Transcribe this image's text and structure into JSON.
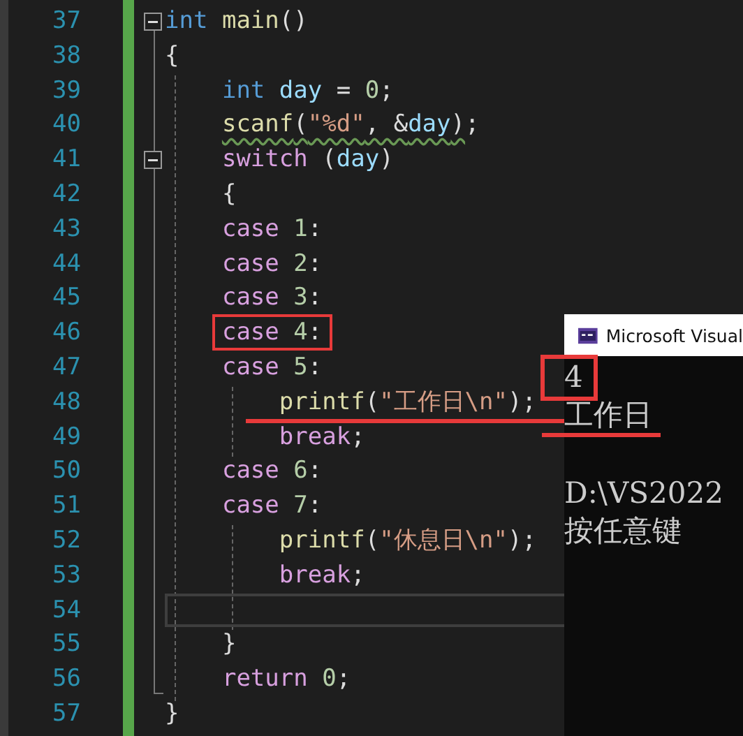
{
  "editor": {
    "lines": [
      {
        "number": "37",
        "fold": true,
        "current": false,
        "boxed": false,
        "underlined": false,
        "tokens": [
          {
            "t": "int",
            "kind": "kw"
          },
          {
            "t": " main",
            "kind": "fn"
          },
          {
            "t": "()",
            "kind": "op"
          }
        ]
      },
      {
        "number": "38",
        "fold": false,
        "current": false,
        "boxed": false,
        "underlined": false,
        "tokens": [
          {
            "t": "{",
            "kind": "op"
          }
        ]
      },
      {
        "number": "39",
        "fold": false,
        "current": false,
        "boxed": false,
        "underlined": false,
        "tokens": [
          {
            "t": "    int",
            "kind": "kw"
          },
          {
            "t": " day",
            "kind": "var"
          },
          {
            "t": " = ",
            "kind": "op"
          },
          {
            "t": "0",
            "kind": "num"
          },
          {
            "t": ";",
            "kind": "op"
          }
        ]
      },
      {
        "number": "40",
        "fold": false,
        "current": false,
        "boxed": false,
        "underlined": false,
        "tokens": [
          {
            "t": "    scanf",
            "kind": "fn",
            "squiggle": true
          },
          {
            "t": "(",
            "kind": "op",
            "squiggle": true
          },
          {
            "t": "\"%d\"",
            "kind": "str",
            "squiggle": true
          },
          {
            "t": ", &",
            "kind": "op",
            "squiggle": true
          },
          {
            "t": "day",
            "kind": "var",
            "squiggle": true
          },
          {
            "t": ")",
            "kind": "op",
            "squiggle": true
          },
          {
            "t": ";",
            "kind": "op",
            "squiggle": false
          }
        ]
      },
      {
        "number": "41",
        "fold": true,
        "current": false,
        "boxed": false,
        "underlined": false,
        "tokens": [
          {
            "t": "    switch",
            "kind": "ctl"
          },
          {
            "t": " (",
            "kind": "op"
          },
          {
            "t": "day",
            "kind": "var"
          },
          {
            "t": ")",
            "kind": "op"
          }
        ]
      },
      {
        "number": "42",
        "fold": false,
        "current": false,
        "boxed": false,
        "underlined": false,
        "tokens": [
          {
            "t": "    {",
            "kind": "op"
          }
        ]
      },
      {
        "number": "43",
        "fold": false,
        "current": false,
        "boxed": false,
        "underlined": false,
        "tokens": [
          {
            "t": "    case",
            "kind": "ctl"
          },
          {
            "t": " 1",
            "kind": "num"
          },
          {
            "t": ":",
            "kind": "op"
          }
        ]
      },
      {
        "number": "44",
        "fold": false,
        "current": false,
        "boxed": false,
        "underlined": false,
        "tokens": [
          {
            "t": "    case",
            "kind": "ctl"
          },
          {
            "t": " 2",
            "kind": "num"
          },
          {
            "t": ":",
            "kind": "op"
          }
        ]
      },
      {
        "number": "45",
        "fold": false,
        "current": false,
        "boxed": false,
        "underlined": false,
        "tokens": [
          {
            "t": "    case",
            "kind": "ctl"
          },
          {
            "t": " 3",
            "kind": "num"
          },
          {
            "t": ":",
            "kind": "op"
          }
        ]
      },
      {
        "number": "46",
        "fold": false,
        "current": false,
        "boxed": true,
        "underlined": false,
        "tokens": [
          {
            "t": "    case",
            "kind": "ctl"
          },
          {
            "t": " 4",
            "kind": "num"
          },
          {
            "t": ":",
            "kind": "op"
          }
        ]
      },
      {
        "number": "47",
        "fold": false,
        "current": false,
        "boxed": false,
        "underlined": false,
        "tokens": [
          {
            "t": "    case",
            "kind": "ctl"
          },
          {
            "t": " 5",
            "kind": "num"
          },
          {
            "t": ":",
            "kind": "op"
          }
        ]
      },
      {
        "number": "48",
        "fold": false,
        "current": false,
        "boxed": false,
        "underlined": true,
        "tokens": [
          {
            "t": "        printf",
            "kind": "fn"
          },
          {
            "t": "(",
            "kind": "op"
          },
          {
            "t": "\"工作日\\n\"",
            "kind": "str"
          },
          {
            "t": ");",
            "kind": "op"
          }
        ]
      },
      {
        "number": "49",
        "fold": false,
        "current": false,
        "boxed": false,
        "underlined": false,
        "tokens": [
          {
            "t": "        break",
            "kind": "ctl"
          },
          {
            "t": ";",
            "kind": "op"
          }
        ]
      },
      {
        "number": "50",
        "fold": false,
        "current": false,
        "boxed": false,
        "underlined": false,
        "tokens": [
          {
            "t": "    case",
            "kind": "ctl"
          },
          {
            "t": " 6",
            "kind": "num"
          },
          {
            "t": ":",
            "kind": "op"
          }
        ]
      },
      {
        "number": "51",
        "fold": false,
        "current": false,
        "boxed": false,
        "underlined": false,
        "tokens": [
          {
            "t": "    case",
            "kind": "ctl"
          },
          {
            "t": " 7",
            "kind": "num"
          },
          {
            "t": ":",
            "kind": "op"
          }
        ]
      },
      {
        "number": "52",
        "fold": false,
        "current": false,
        "boxed": false,
        "underlined": false,
        "tokens": [
          {
            "t": "        printf",
            "kind": "fn"
          },
          {
            "t": "(",
            "kind": "op"
          },
          {
            "t": "\"休息日\\n\"",
            "kind": "str"
          },
          {
            "t": ");",
            "kind": "op"
          }
        ]
      },
      {
        "number": "53",
        "fold": false,
        "current": false,
        "boxed": false,
        "underlined": false,
        "tokens": [
          {
            "t": "        break",
            "kind": "ctl"
          },
          {
            "t": ";",
            "kind": "op"
          }
        ]
      },
      {
        "number": "54",
        "fold": false,
        "current": true,
        "boxed": false,
        "underlined": false
      },
      {
        "number": "55",
        "fold": false,
        "current": false,
        "boxed": false,
        "underlined": false,
        "tokens": [
          {
            "t": "    }",
            "kind": "op"
          }
        ]
      },
      {
        "number": "56",
        "fold": false,
        "current": false,
        "boxed": false,
        "underlined": false,
        "tokens": [
          {
            "t": "    return",
            "kind": "ctl"
          },
          {
            "t": " 0",
            "kind": "num"
          },
          {
            "t": ";",
            "kind": "op"
          }
        ]
      },
      {
        "number": "57",
        "fold": false,
        "current": false,
        "boxed": false,
        "underlined": false,
        "tokens": [
          {
            "t": "}",
            "kind": "op"
          }
        ]
      }
    ]
  },
  "console": {
    "title": "Microsoft Visual",
    "lines": [
      {
        "text": "4",
        "blank_before": false,
        "boxed": true,
        "underlined": false
      },
      {
        "text": "工作日",
        "blank_before": false,
        "boxed": false,
        "underlined": true
      },
      {
        "text": "D:\\VS2022",
        "blank_before": true,
        "boxed": false,
        "underlined": false
      },
      {
        "text": "按任意键",
        "blank_before": false,
        "boxed": false,
        "underlined": false
      }
    ]
  }
}
